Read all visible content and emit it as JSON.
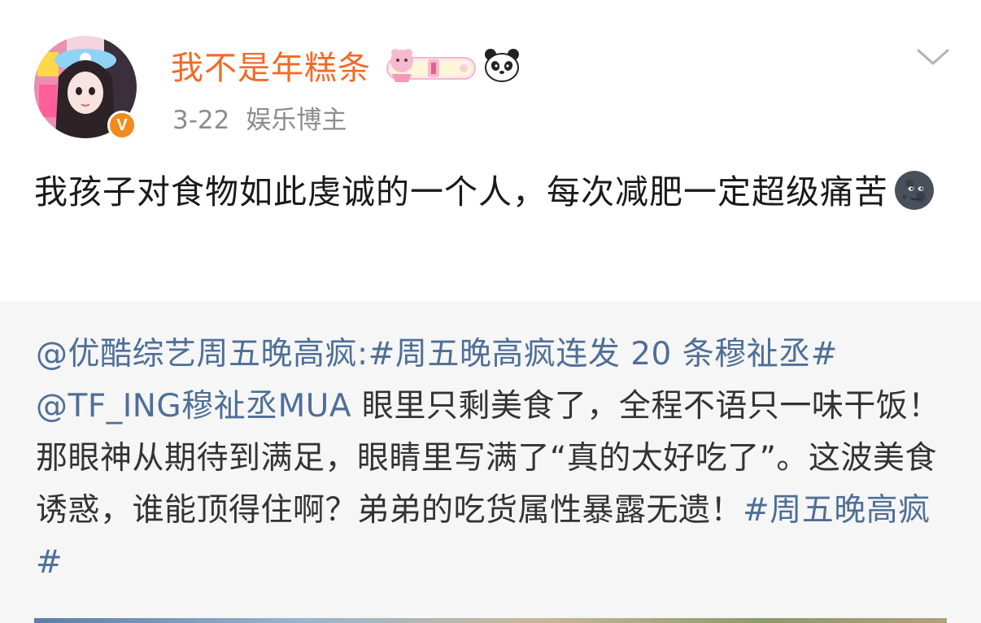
{
  "post": {
    "author": {
      "name": "我不是年糕条",
      "verified_mark": "V"
    },
    "date": "3-22",
    "tag": "娱乐博主",
    "text": "我孩子对食物如此虔诚的一个人，每次减肥一定超级痛苦"
  },
  "repost": {
    "mention1": "@优酷综艺周五晚高疯",
    "colon": ":",
    "topic1": "#周五晚高疯连发 20 条穆祉丞#",
    "mention2": "@TF_ING穆祉丞MUA",
    "body": " 眼里只剩美食了，全程不语只一味干饭！那眼神从期待到满足，眼睛里写满了“真的太好吃了”。这波美食诱惑，谁能顶得住啊？弟弟的吃货属性暴露无遗！",
    "topic2": "#周五晚高疯#"
  },
  "icons": {
    "verified": "verified-v-badge",
    "vip": "vip-badge",
    "panda": "panda-emoji",
    "chevron": "chevron-down-icon",
    "moon": "new-moon-face-emoji"
  },
  "colors": {
    "username": "#f26a25",
    "link": "#4e6f97",
    "verified": "#f38a1d",
    "repost_bg": "#f6f6f6"
  }
}
